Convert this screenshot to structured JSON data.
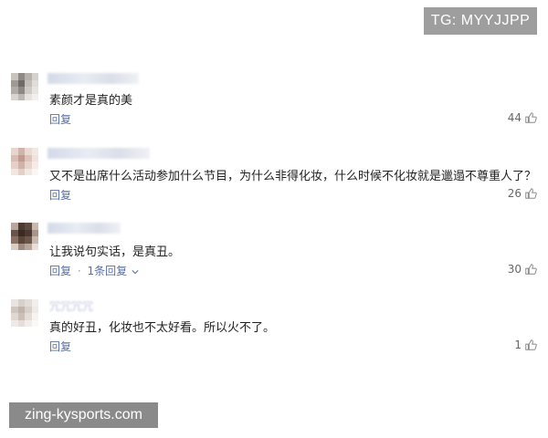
{
  "watermarks": {
    "top": "TG: MYYJJPP",
    "bottom": "zing-kysports.com"
  },
  "comments": [
    {
      "username": "",
      "text": "素颜才是真的美",
      "reply_label": "回复",
      "replies_label": "",
      "likes": "44"
    },
    {
      "username": "",
      "text": "又不是出席什么活动参加什么节目，为什么非得化妆，什么时候不化妆就是邋遢不尊重人了？",
      "reply_label": "回复",
      "replies_label": "",
      "likes": "26"
    },
    {
      "username": "",
      "text": "让我说句实话，是真丑。",
      "reply_label": "回复",
      "replies_label": "1条回复",
      "likes": "30"
    },
    {
      "username": "冗冗冗冗",
      "text": "真的好丑，化妆也不太好看。所以火不了。",
      "reply_label": "回复",
      "replies_label": "",
      "likes": "1"
    }
  ]
}
